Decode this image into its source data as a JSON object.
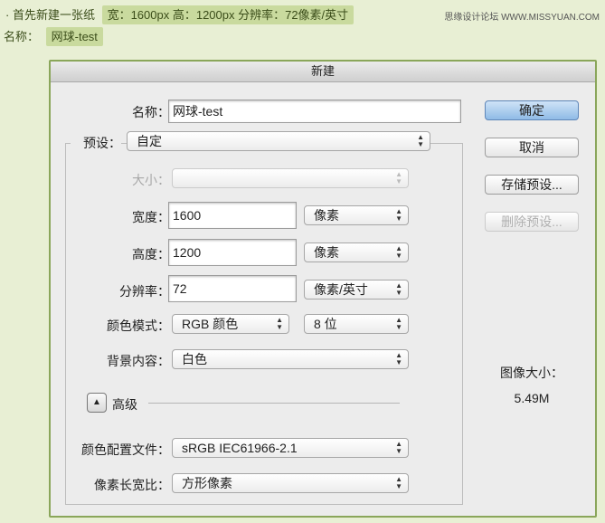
{
  "tutorial": {
    "step_text": "· 首先新建一张纸",
    "spec": "宽：1600px  高：1200px  分辨率：72像素/英寸",
    "name_label": "名称：",
    "name_value": "网球-test",
    "watermark": "思缘设计论坛  WWW.MISSYUAN.COM"
  },
  "dialog": {
    "title": "新建",
    "name_label": "名称：",
    "name_value": "网球-test",
    "preset_label": "预设：",
    "preset_value": "自定",
    "size_label": "大小：",
    "size_value": "",
    "width_label": "宽度：",
    "width_value": "1600",
    "width_unit": "像素",
    "height_label": "高度：",
    "height_value": "1200",
    "height_unit": "像素",
    "resolution_label": "分辨率：",
    "resolution_value": "72",
    "resolution_unit": "像素/英寸",
    "color_mode_label": "颜色模式：",
    "color_mode_value": "RGB 颜色",
    "bit_depth_value": "8 位",
    "background_label": "背景内容：",
    "background_value": "白色",
    "advanced_label": "高级",
    "color_profile_label": "颜色配置文件：",
    "color_profile_value": "sRGB IEC61966-2.1",
    "pixel_aspect_label": "像素长宽比：",
    "pixel_aspect_value": "方形像素",
    "buttons": {
      "ok": "确定",
      "cancel": "取消",
      "save_preset": "存储预设...",
      "delete_preset": "删除预设..."
    },
    "image_size_label": "图像大小：",
    "image_size_value": "5.49M"
  }
}
